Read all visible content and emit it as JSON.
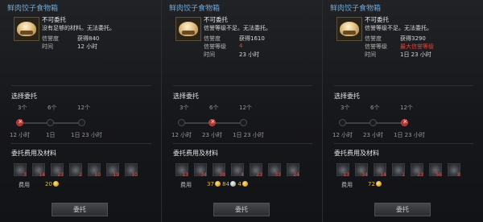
{
  "panels": [
    {
      "title": "鲜肉饺子食物箱",
      "item_name": "不可委托",
      "desc": "没有足够的材料。无法委托。",
      "row1_label": "信誉度",
      "row1_value": "获得840",
      "row2_label": "时间",
      "row2_value": "12 小时",
      "section_select": "选择委托",
      "counts": [
        "3个",
        "6个",
        "12个"
      ],
      "times": [
        "12 小时",
        "1日",
        "1日 23 小时"
      ],
      "section_materials": "委托费用及材料",
      "mat_qty": [
        "3",
        "14",
        "23",
        "2",
        "10",
        "19",
        "10"
      ],
      "fee_label": "费用",
      "fee_gold": "20",
      "button": "委托"
    },
    {
      "title": "鲜肉饺子食物箱",
      "item_name": "不可委托",
      "desc": "信誉等级不足。无法委托。",
      "row1_label": "信誉度",
      "row1_value": "获得1610",
      "row2_label": "信誉等级",
      "row2_value": "4",
      "row3_label": "时间",
      "row3_value": "23 小时",
      "section_select": "选择委托",
      "counts": [
        "3个",
        "6个",
        "12个"
      ],
      "times": [
        "12 小时",
        "23 小时",
        "1日 23 小时"
      ],
      "section_materials": "委托费用及材料",
      "mat_qty": [
        "13",
        "34",
        "38",
        "4",
        "23",
        "33",
        "24"
      ],
      "fee_label": "费用",
      "fee_gold": "37",
      "fee_silver": "84",
      "fee_gold2": "4",
      "button": "委托"
    },
    {
      "title": "鲜肉饺子食物箱",
      "item_name": "不可委托",
      "desc": "信誉等级不足。无法委托。",
      "row1_label": "信誉度",
      "row1_value": "获得3290",
      "row2_label": "信誉等级",
      "row2_value": "最大信誉等级",
      "row3_label": "时间",
      "row3_value": "1日 23 小时",
      "section_select": "选择委托",
      "counts": [
        "3个",
        "6个",
        "12个"
      ],
      "times": [
        "12 小时",
        "23 小时",
        "1日 23 小时"
      ],
      "section_materials": "委托费用及材料",
      "mat_qty": [
        "13",
        "34",
        "14",
        "1",
        "23",
        "56",
        "8"
      ],
      "fee_label": "费用",
      "fee_gold": "72",
      "button": "委托"
    }
  ],
  "colors": {
    "title": "#6fa8d6",
    "warn": "#e0463c",
    "gold": "#e0b840",
    "selected_node": "#e25b4d"
  },
  "icons": [
    "dumpling-box-icon",
    "material-icon",
    "gold-coin-icon",
    "silver-coin-icon",
    "close-icon"
  ]
}
